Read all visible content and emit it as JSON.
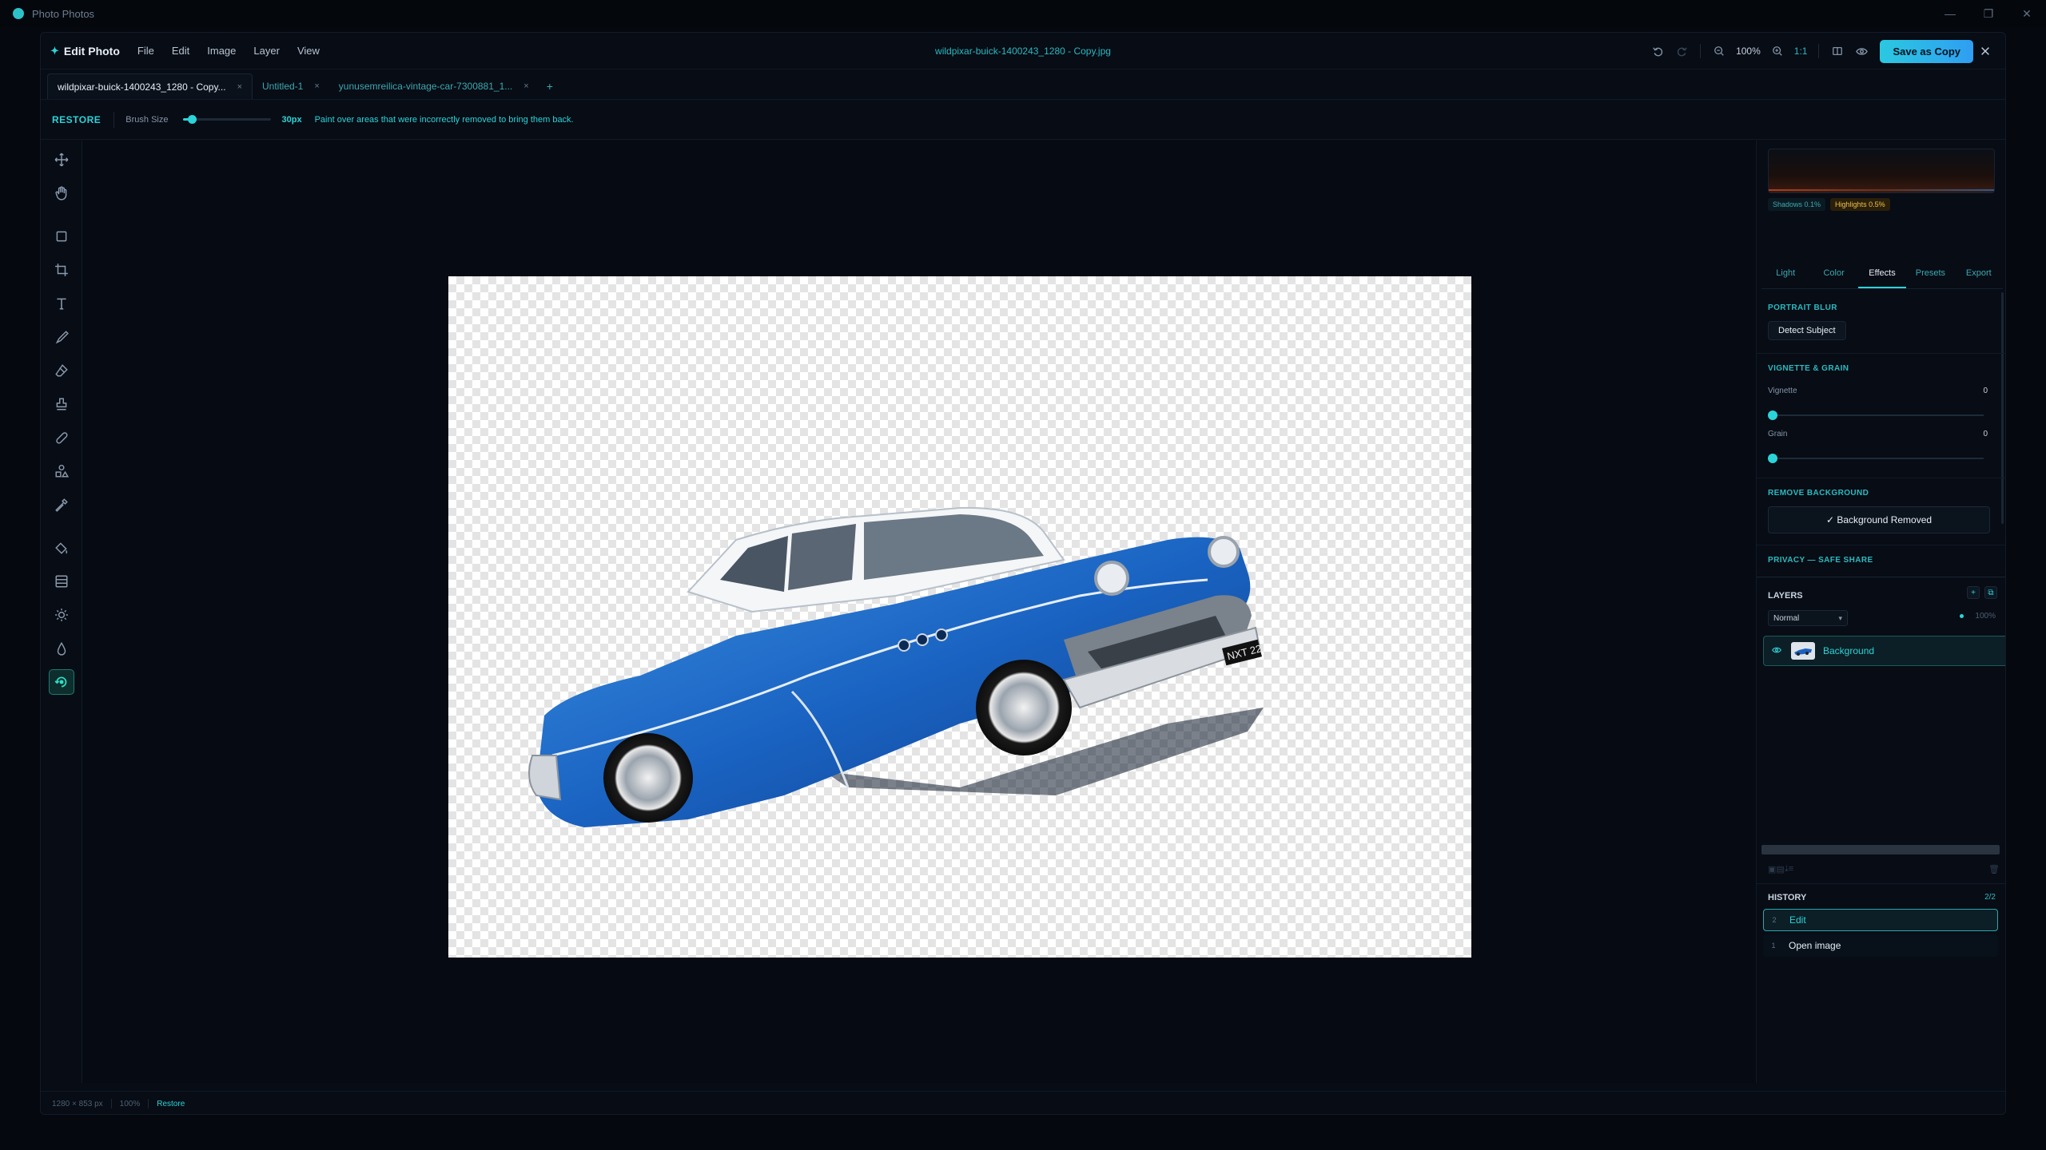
{
  "os": {
    "title": "Photo Photos",
    "controls": [
      "—",
      "❐",
      "✕"
    ]
  },
  "topbar": {
    "brand": "Edit Photo",
    "menu": [
      "File",
      "Edit",
      "Image",
      "Layer",
      "View"
    ],
    "doc_title": "wildpixar-buick-1400243_1280 - Copy.jpg",
    "zoom": "100%",
    "ratio": "1:1",
    "save_label": "Save as Copy"
  },
  "tabs": [
    {
      "label": "wildpixar-buick-1400243_1280 - Copy...",
      "active": true
    },
    {
      "label": "Untitled-1",
      "active": false
    },
    {
      "label": "yunusemreilica-vintage-car-7300881_1...",
      "active": false
    }
  ],
  "options": {
    "mode": "RESTORE",
    "brush_label": "Brush Size",
    "brush_value": "30px",
    "brush_fraction": 0.1,
    "hint": "Paint over areas that were incorrectly removed to bring them back."
  },
  "tools": [
    "move-icon",
    "hand-icon",
    "marquee-icon",
    "crop-icon",
    "text-icon",
    "brush-icon",
    "eraser-icon",
    "stamp-icon",
    "heal-icon",
    "shapes-icon",
    "eyedropper-icon",
    "fill-icon",
    "gradient-icon",
    "adjust-icon",
    "blur-icon",
    "restore-icon"
  ],
  "panel": {
    "badges": {
      "shadows": "Shadows 0.1%",
      "highlights": "Highlights 0.5%"
    },
    "tabs": [
      {
        "label": "Light",
        "active": false
      },
      {
        "label": "Color",
        "active": false
      },
      {
        "label": "Effects",
        "active": true
      },
      {
        "label": "Presets",
        "active": false
      },
      {
        "label": "Export",
        "active": false
      }
    ],
    "portrait_blur": "PORTRAIT BLUR",
    "detect_subject": "Detect Subject",
    "vignette_grain": "VIGNETTE & GRAIN",
    "vignette_label": "Vignette",
    "vignette_value": "0",
    "grain_label": "Grain",
    "grain_value": "0",
    "remove_background": "REMOVE BACKGROUND",
    "background_removed": "✓ Background Removed",
    "privacy": "PRIVACY — SAFE SHARE"
  },
  "layers": {
    "title": "LAYERS",
    "blend_mode": "Normal",
    "opacity": "100%",
    "items": [
      {
        "name": "Background",
        "visible": true
      }
    ]
  },
  "history": {
    "title": "HISTORY",
    "count": "2/2",
    "items": [
      {
        "num": "2",
        "label": "Edit",
        "active": true
      },
      {
        "num": "1",
        "label": "Open image",
        "active": false
      }
    ]
  },
  "status": {
    "dimensions": "1280 × 853 px",
    "zoom": "100%",
    "mode": "Restore"
  },
  "colors": {
    "accent": "#2bd4d8",
    "background": "#070c15",
    "save_button": "#2bc8e0"
  }
}
